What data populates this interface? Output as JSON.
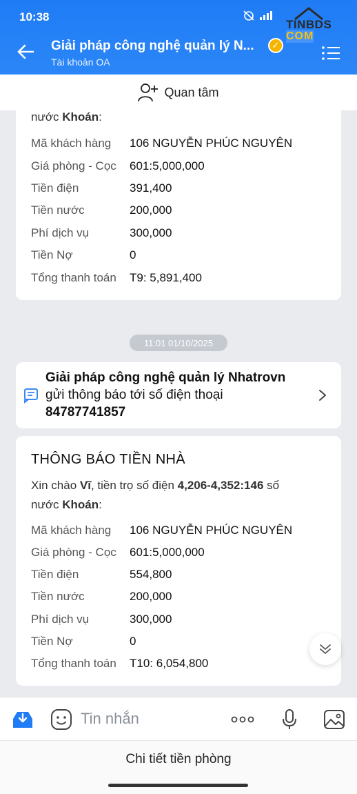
{
  "status": {
    "time": "10:38"
  },
  "watermark": {
    "line1": "TINBDS",
    "line2": "COM"
  },
  "header": {
    "title": "Giải pháp công nghệ quản lý N...",
    "subtitle": "Tài khoản OA"
  },
  "follow": {
    "label": "Quan tâm"
  },
  "card1": {
    "intro_partial": "nước ",
    "intro_bold": "Khoán",
    "intro_end": ":",
    "rows": [
      {
        "k": "Mã khách hàng",
        "v": "106 NGUYỄN PHÚC NGUYÊN"
      },
      {
        "k": "Giá phòng - Cọc",
        "v": "601:5,000,000"
      },
      {
        "k": "Tiền điện",
        "v": "391,400"
      },
      {
        "k": "Tiền nước",
        "v": "200,000"
      },
      {
        "k": "Phí dịch vụ",
        "v": "300,000"
      },
      {
        "k": "Tiền Nợ",
        "v": "0"
      },
      {
        "k": "Tổng thanh toán",
        "v": "T9: 5,891,400"
      }
    ]
  },
  "timestamp": "11:01 01/10/2025",
  "notice": {
    "sender": "Giải pháp công nghệ quản lý Nhatrovn",
    "line2": "gửi thông báo tới số điện thoại",
    "phone": "84787741857"
  },
  "card2": {
    "title": "THÔNG BÁO TIỀN NHÀ",
    "greet": "Xin chào ",
    "name": "Vĩ",
    "mid": ", tiền trọ số điện ",
    "reading": "4,206-4,352:146",
    "after": " số",
    "line2_start": "nước ",
    "line2_bold": "Khoán",
    "line2_end": ":",
    "rows": [
      {
        "k": "Mã khách hàng",
        "v": "106 NGUYỄN PHÚC NGUYÊN"
      },
      {
        "k": "Giá phòng - Cọc",
        "v": "601:5,000,000"
      },
      {
        "k": "Tiền điện",
        "v": "554,800"
      },
      {
        "k": "Tiền nước",
        "v": "200,000"
      },
      {
        "k": "Phí dịch vụ",
        "v": "300,000"
      },
      {
        "k": "Tiền Nợ",
        "v": "0"
      },
      {
        "k": "Tổng thanh toán",
        "v": "T10: 6,054,800"
      }
    ]
  },
  "input": {
    "placeholder": "Tin nhắn"
  },
  "bottom_menu": {
    "label": "Chi tiết tiền phòng"
  },
  "colors": {
    "header": "#1f7cf5",
    "accent": "#1f7cf5",
    "verified": "#f4b400"
  }
}
